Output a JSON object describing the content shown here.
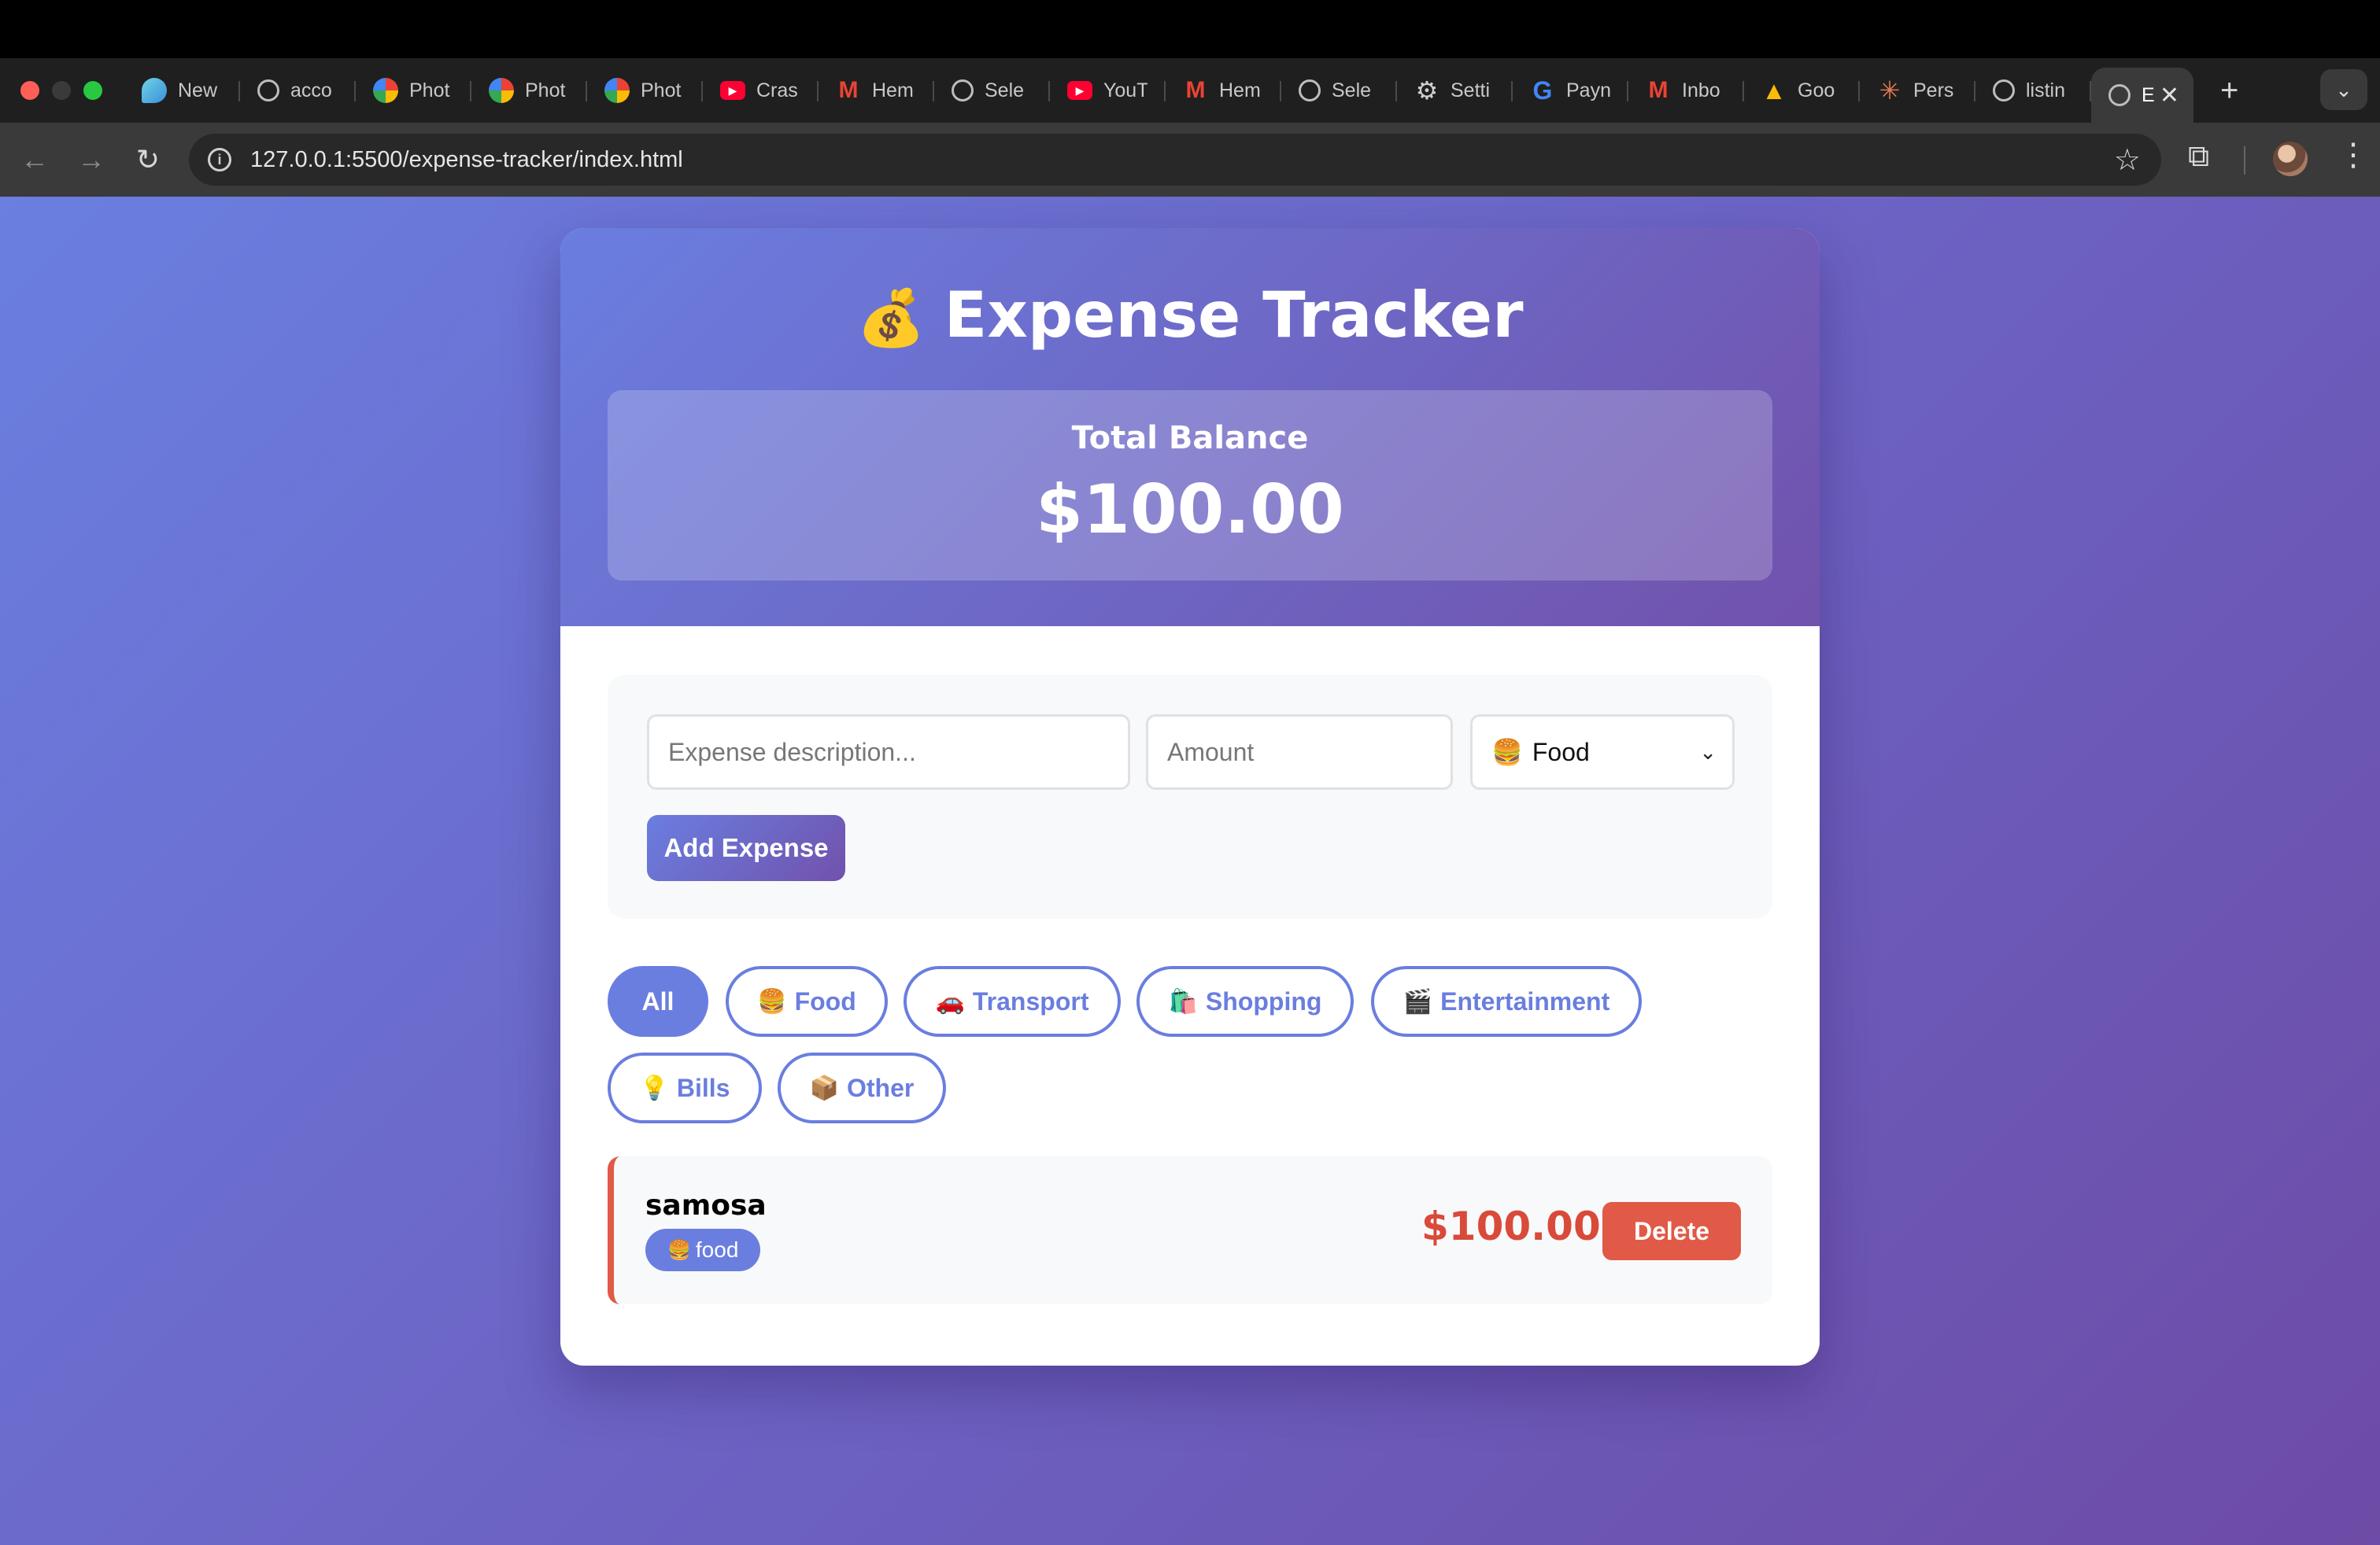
{
  "browser": {
    "tabs": [
      {
        "label": "New",
        "icon": "drop-icon"
      },
      {
        "label": "acco",
        "icon": "globe-icon"
      },
      {
        "label": "Phot",
        "icon": "photos-icon"
      },
      {
        "label": "Phot",
        "icon": "photos-icon"
      },
      {
        "label": "Phot",
        "icon": "photos-icon"
      },
      {
        "label": "Cras",
        "icon": "youtube-icon"
      },
      {
        "label": "Hem",
        "icon": "gmail-icon"
      },
      {
        "label": "Sele",
        "icon": "globe-icon"
      },
      {
        "label": "YouT",
        "icon": "youtube-icon"
      },
      {
        "label": "Hem",
        "icon": "gmail-icon"
      },
      {
        "label": "Sele",
        "icon": "globe-icon"
      },
      {
        "label": "Setti",
        "icon": "gear-icon"
      },
      {
        "label": "Payn",
        "icon": "google-icon"
      },
      {
        "label": "Inbo",
        "icon": "gmail-icon"
      },
      {
        "label": "Goo",
        "icon": "google-ads-icon"
      },
      {
        "label": "Pers",
        "icon": "spark-icon"
      },
      {
        "label": "listin",
        "icon": "globe-icon"
      }
    ],
    "active_tab": {
      "label": "E",
      "icon": "globe-icon"
    },
    "url": "127.0.0.1:5500/expense-tracker/index.html"
  },
  "app": {
    "title_emoji": "💰",
    "title": "Expense Tracker",
    "balance_label": "Total Balance",
    "balance_amount": "$100.00",
    "form": {
      "description_placeholder": "Expense description...",
      "amount_placeholder": "Amount",
      "category_emoji": "🍔",
      "category_selected": "Food",
      "add_button": "Add Expense"
    },
    "filters": [
      {
        "emoji": "",
        "label": "All",
        "active": true
      },
      {
        "emoji": "🍔",
        "label": "Food"
      },
      {
        "emoji": "🚗",
        "label": "Transport"
      },
      {
        "emoji": "🛍️",
        "label": "Shopping"
      },
      {
        "emoji": "🎬",
        "label": "Entertainment"
      },
      {
        "emoji": "💡",
        "label": "Bills"
      },
      {
        "emoji": "📦",
        "label": "Other"
      }
    ],
    "expenses": [
      {
        "name": "samosa",
        "tag_emoji": "🍔",
        "tag": "food",
        "amount": "$100.00",
        "delete_label": "Delete"
      }
    ]
  },
  "colors": {
    "accent": "#6a7ee0",
    "accent_dark": "#7152ac",
    "danger": "#e05a47"
  }
}
